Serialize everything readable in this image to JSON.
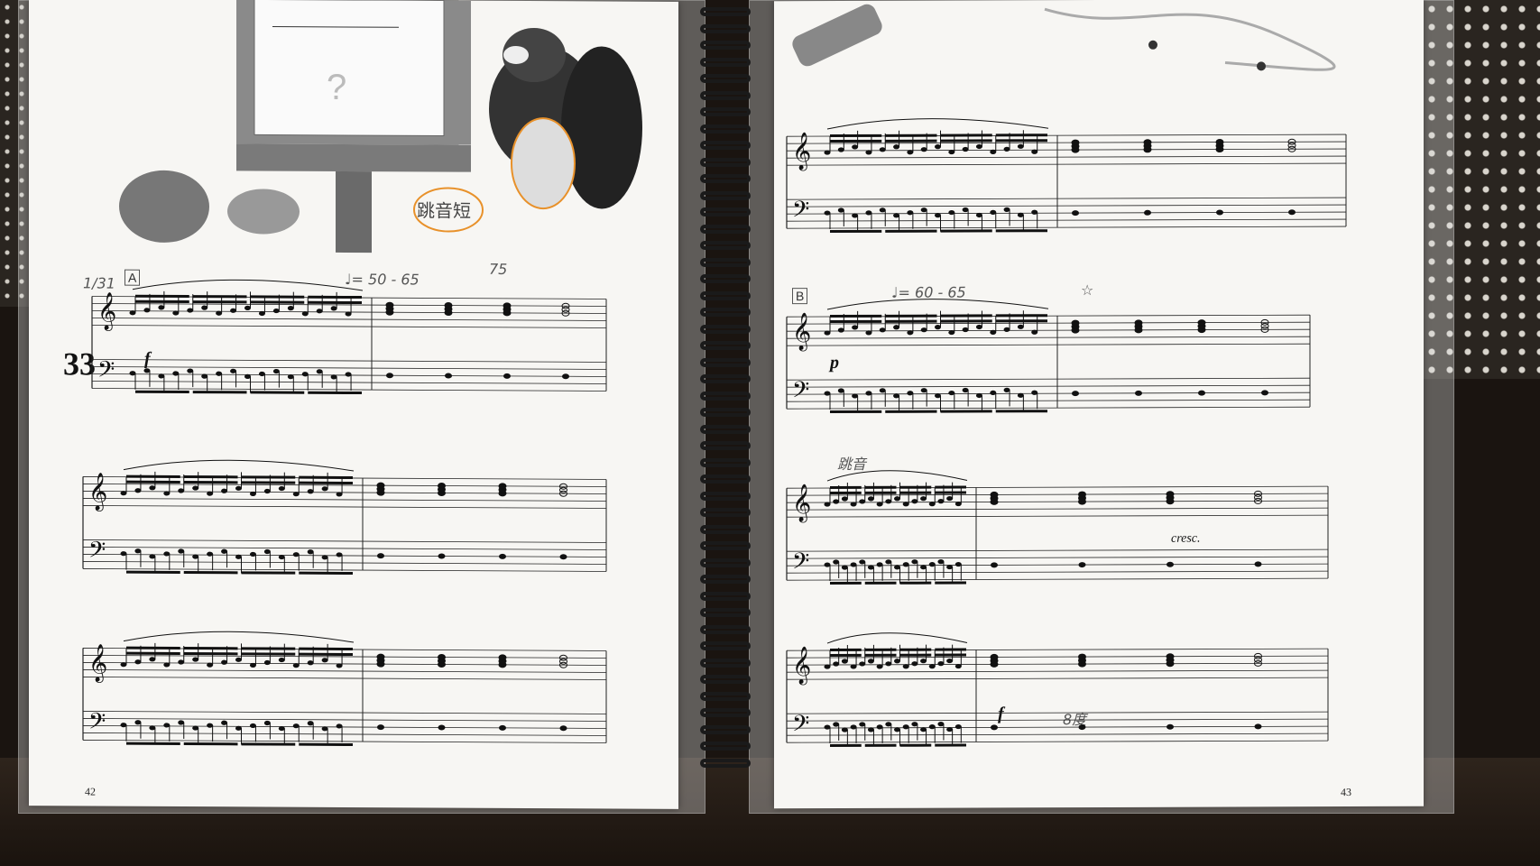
{
  "book": {
    "left_page_number": "42",
    "right_page_number": "43",
    "piece_number": "33"
  },
  "sections": {
    "a_label": "A",
    "b_label": "B"
  },
  "dynamics": {
    "left_forte": "f",
    "right_piano": "p",
    "right_forte": "f",
    "crescendo": "cresc."
  },
  "annotations": {
    "tempo_a": "♩= 50 - 65",
    "tempo_b": "♩= 60 - 65",
    "count_75": "75",
    "date": "1/31",
    "note_jump": "跳音",
    "note_8va": "8度",
    "star": "☆"
  },
  "colors": {
    "paper": "#f7f6f3",
    "ink": "#111111",
    "pencil": "#555555",
    "highlight_orange": "#e8912a",
    "highlight_red": "#d9534f"
  }
}
